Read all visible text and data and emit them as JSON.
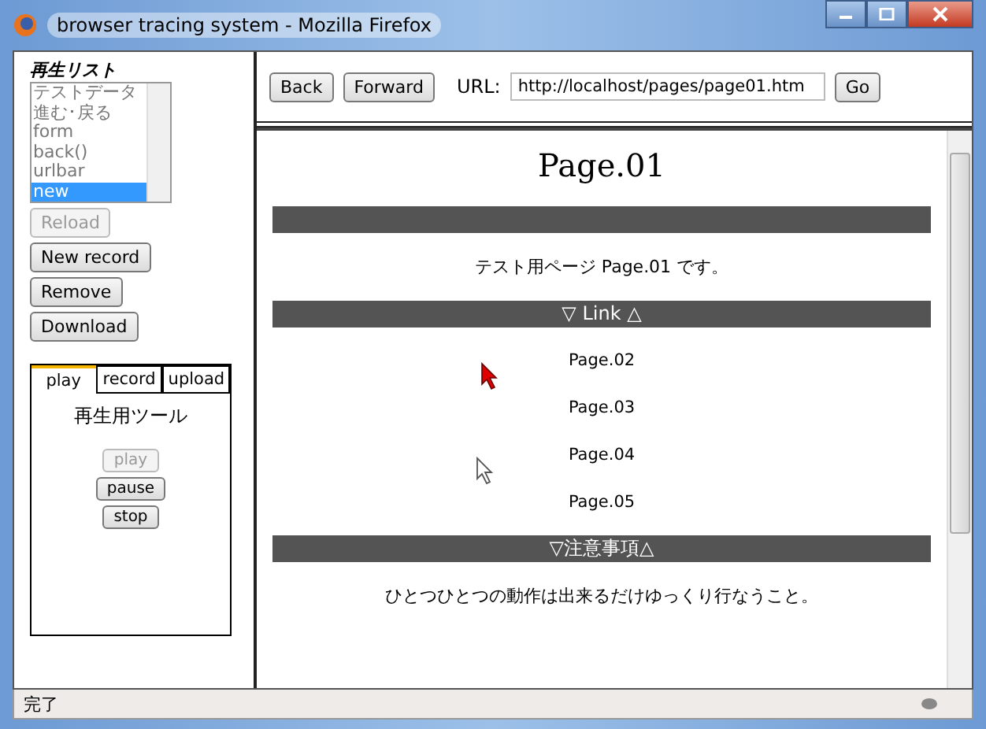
{
  "window": {
    "title": "browser tracing system - Mozilla Firefox"
  },
  "sidebar": {
    "list_title": "再生リスト",
    "list_items": [
      {
        "label": "テストデータ",
        "selected": false
      },
      {
        "label": "進む･戻る",
        "selected": false
      },
      {
        "label": "form",
        "selected": false
      },
      {
        "label": "back()",
        "selected": false
      },
      {
        "label": "urlbar",
        "selected": false
      },
      {
        "label": "new",
        "selected": true
      }
    ],
    "buttons": [
      {
        "label": "Reload",
        "disabled": true
      },
      {
        "label": "New record",
        "disabled": false
      },
      {
        "label": "Remove",
        "disabled": false
      },
      {
        "label": "Download",
        "disabled": false
      }
    ],
    "tabs": [
      {
        "label": "play",
        "selected": true
      },
      {
        "label": "record",
        "selected": false
      },
      {
        "label": "upload",
        "selected": false
      }
    ],
    "tab_heading": "再生用ツール",
    "tool_buttons": [
      {
        "label": "play",
        "disabled": true
      },
      {
        "label": "pause",
        "disabled": false
      },
      {
        "label": "stop",
        "disabled": false
      }
    ]
  },
  "toolbar": {
    "back": "Back",
    "forward": "Forward",
    "url_label": "URL:",
    "url": "http://localhost/pages/page01.htm",
    "go": "Go"
  },
  "page": {
    "title": "Page.01",
    "intro": "テスト用ページ Page.01 です。",
    "link_heading": "▽ Link △",
    "links": [
      "Page.02",
      "Page.03",
      "Page.04",
      "Page.05"
    ],
    "notes_heading": "▽注意事項△",
    "note": "ひとつひとつの動作は出来るだけゆっくり行なうこと。"
  },
  "status_bar": {
    "text": "完了"
  }
}
